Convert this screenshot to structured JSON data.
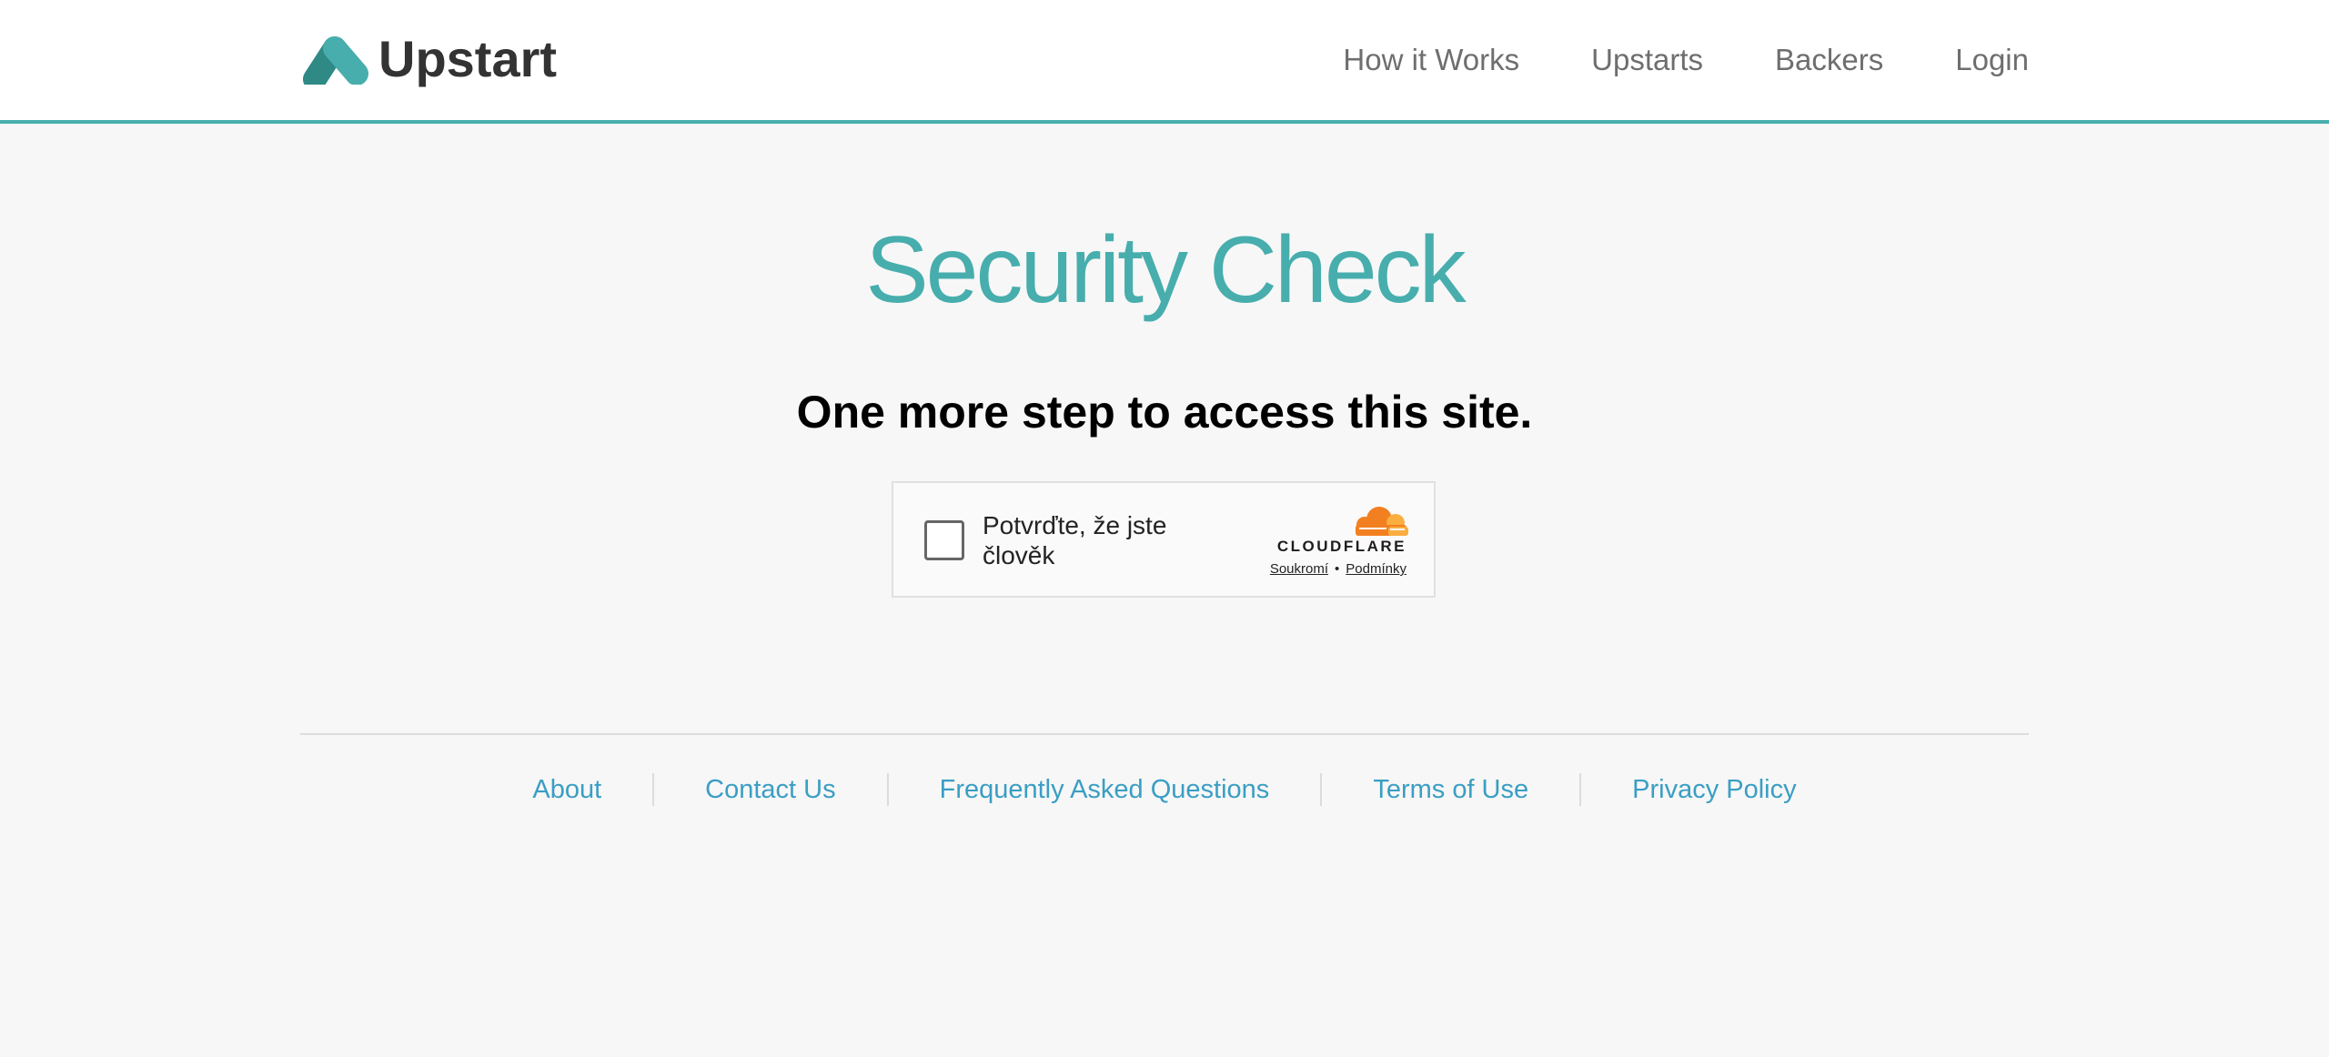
{
  "header": {
    "logo_text": "Upstart",
    "nav": [
      "How it Works",
      "Upstarts",
      "Backers",
      "Login"
    ]
  },
  "main": {
    "title": "Security Check",
    "subtitle": "One more step to access this site."
  },
  "captcha": {
    "label": "Potvrďte, že jste člověk",
    "brand": "CLOUDFLARE",
    "privacy_link": "Soukromí",
    "separator": "•",
    "terms_link": "Podmínky",
    "checked": false
  },
  "footer": {
    "links": [
      "About",
      "Contact Us",
      "Frequently Asked Questions",
      "Terms of Use",
      "Privacy Policy"
    ]
  },
  "colors": {
    "accent": "#47aead",
    "link": "#3a9ec4",
    "cloudflare_orange": "#f38020"
  },
  "icons": {
    "logo": "upstart-logo-icon",
    "checkbox": "checkbox-icon",
    "cloudflare": "cloudflare-logo-icon"
  }
}
